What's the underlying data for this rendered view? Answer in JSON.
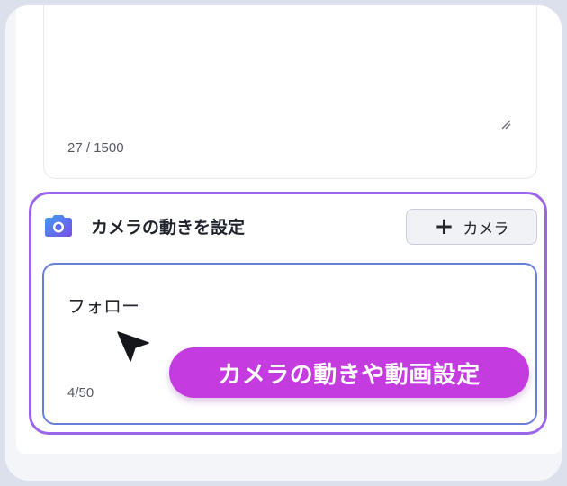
{
  "prompt_area": {
    "counter": "27 / 1500"
  },
  "camera_section": {
    "title": "カメラの動きを設定",
    "add_button_label": "カメラ",
    "input_value": "フォロー",
    "counter": "4/50"
  },
  "callout": {
    "text": "カメラの動きや動画設定"
  },
  "colors": {
    "section_border": "#9b67ea",
    "input_border": "#6a7fd8",
    "callout_bg": "#c43be0",
    "camera_icon_gradient": [
      "#3aa0f4",
      "#7b4be8"
    ]
  },
  "icons": {
    "camera": "camera-icon",
    "plus": "plus-icon",
    "resize": "resize-handle-icon",
    "cursor": "cursor-arrow-icon"
  }
}
